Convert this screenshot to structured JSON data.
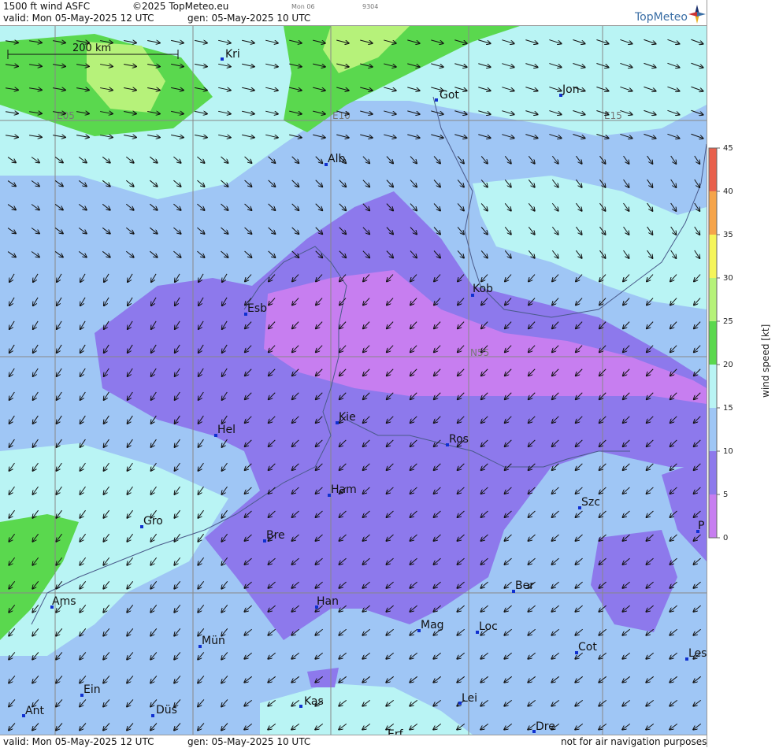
{
  "header": {
    "product": "1500 ft wind ASFC",
    "copyright": "©2025 TopMeteo.eu",
    "small_day": "Mon 06",
    "small_code": "9304",
    "valid": "valid:  Mon  05-May-2025  12 UTC",
    "gen": "gen: 05-May-2025 10 UTC",
    "logo": "TopMeteo"
  },
  "footer": {
    "valid": "valid:  Mon  05-May-2025  12 UTC",
    "gen": "gen: 05-May-2025 10 UTC",
    "note": "not for air navigation purposes"
  },
  "map": {
    "scale_label": "200 km",
    "grid_labels": [
      "E05",
      "E10",
      "E15",
      "N55"
    ],
    "cities": [
      "Kri",
      "Got",
      "Jon",
      "Alb",
      "Esb",
      "Kob",
      "Kie",
      "Hel",
      "Ros",
      "Ham",
      "Szc",
      "Gro",
      "Bre",
      "P",
      "Ber",
      "Ams",
      "Han",
      "Mag",
      "Loc",
      "Mün",
      "Cot",
      "Les",
      "Ein",
      "Kas",
      "Lei",
      "Ant",
      "Düs",
      "Dre",
      "Erf"
    ]
  },
  "legend": {
    "title": "wind speed [kt]",
    "ticks": [
      "45",
      "40",
      "35",
      "30",
      "25",
      "20",
      "15",
      "10",
      "5",
      "0"
    ],
    "colors": {
      "45": "#e8604c",
      "35": "#f5a44a",
      "30": "#f5f55a",
      "25": "#b6f27a",
      "20": "#5ad84e",
      "15": "#b9f4f4",
      "10": "#9fc6f5",
      "5": "#8d79ec",
      "0": "#c77ef0"
    }
  }
}
